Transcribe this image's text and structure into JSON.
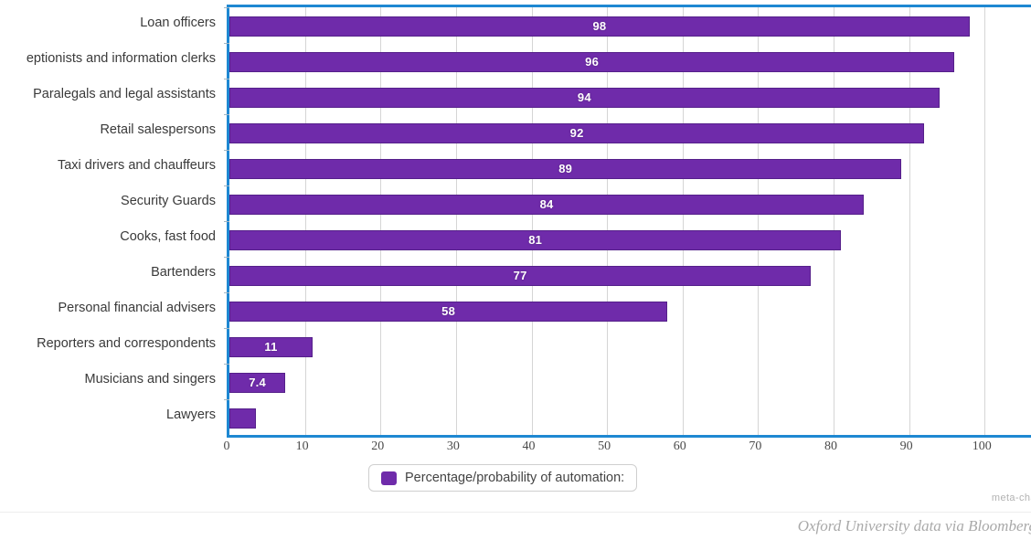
{
  "chart_data": {
    "type": "bar",
    "orientation": "horizontal",
    "title": "",
    "xlabel": "",
    "ylabel": "",
    "xlim": [
      0,
      106.5
    ],
    "xticks": [
      0,
      10,
      20,
      30,
      40,
      50,
      60,
      70,
      80,
      90,
      100
    ],
    "grid": true,
    "legend_position": "bottom",
    "series_name": "Percentage/probability of automation:",
    "bar_color": "#6f2baa",
    "axis_color": "#1e88d2",
    "categories": [
      "Loan officers",
      "eptionists and information clerks",
      "Paralegals and legal assistants",
      "Retail salespersons",
      "Taxi drivers and chauffeurs",
      "Security Guards",
      "Cooks, fast food",
      "Bartenders",
      "Personal financial advisers",
      "Reporters and correspondents",
      "Musicians and singers",
      "Lawyers"
    ],
    "values": [
      98,
      96,
      94,
      92,
      89,
      84,
      81,
      77,
      58,
      11,
      7.4,
      3.5
    ],
    "value_labels": [
      "98",
      "96",
      "94",
      "92",
      "89",
      "84",
      "81",
      "77",
      "58",
      "11",
      "7.4",
      ""
    ]
  },
  "legend": {
    "label": "Percentage/probability of automation:",
    "swatch_color": "#6f2baa"
  },
  "footer": {
    "watermark": "meta-char",
    "credit": "Oxford University data via Bloomberg"
  }
}
